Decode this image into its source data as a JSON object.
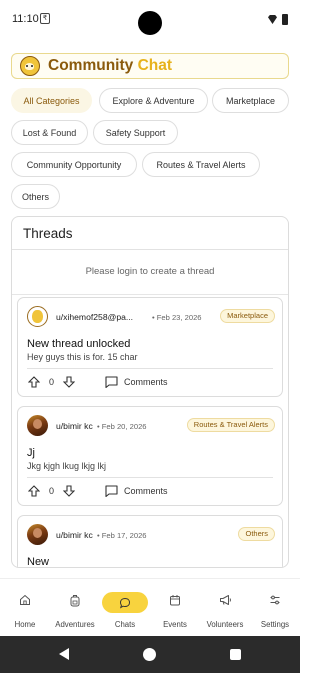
{
  "status_bar": {
    "time": "11:10",
    "app_icon": "₹"
  },
  "header": {
    "title_part1": "Community",
    "title_part2": "Chat"
  },
  "categories": [
    {
      "label": "All Categories",
      "active": true
    },
    {
      "label": "Explore & Adventure"
    },
    {
      "label": "Marketplace"
    },
    {
      "label": "Lost & Found"
    },
    {
      "label": "Safety Support"
    },
    {
      "label": "Community Opportunity"
    },
    {
      "label": "Routes & Travel Alerts"
    },
    {
      "label": "Others"
    }
  ],
  "threads": {
    "heading": "Threads",
    "login_prompt": "Please login to create a thread",
    "items": [
      {
        "username": "u/xihemof258@pa...",
        "date": "• Feb 23, 2026",
        "tag": "Marketplace",
        "title": "New thread unlocked",
        "body": "Hey guys this is for. 15 char",
        "votes": "0",
        "comments_label": "Comments"
      },
      {
        "username": "u/bimir kc",
        "date": "• Feb 20, 2026",
        "tag": "Routes & Travel Alerts",
        "title": "Jj",
        "body": "Jkg kjgh lkug lkjg lkj",
        "votes": "0",
        "comments_label": "Comments"
      },
      {
        "username": "u/bimir kc",
        "date": "• Feb 17, 2026",
        "tag": "Others",
        "title": "New"
      }
    ]
  },
  "bottom_nav": [
    {
      "label": "Home",
      "icon": "home-icon"
    },
    {
      "label": "Adventures",
      "icon": "backpack-icon"
    },
    {
      "label": "Chats",
      "icon": "chat-bubble-icon",
      "active": true
    },
    {
      "label": "Events",
      "icon": "calendar-icon"
    },
    {
      "label": "Volunteers",
      "icon": "megaphone-icon"
    },
    {
      "label": "Settings",
      "icon": "sliders-icon"
    }
  ],
  "colors": {
    "accent": "#f8d33e",
    "brand_dark": "#8a5a0c",
    "brand_light": "#e7b21c",
    "tag_bg": "#fdf6dc"
  }
}
